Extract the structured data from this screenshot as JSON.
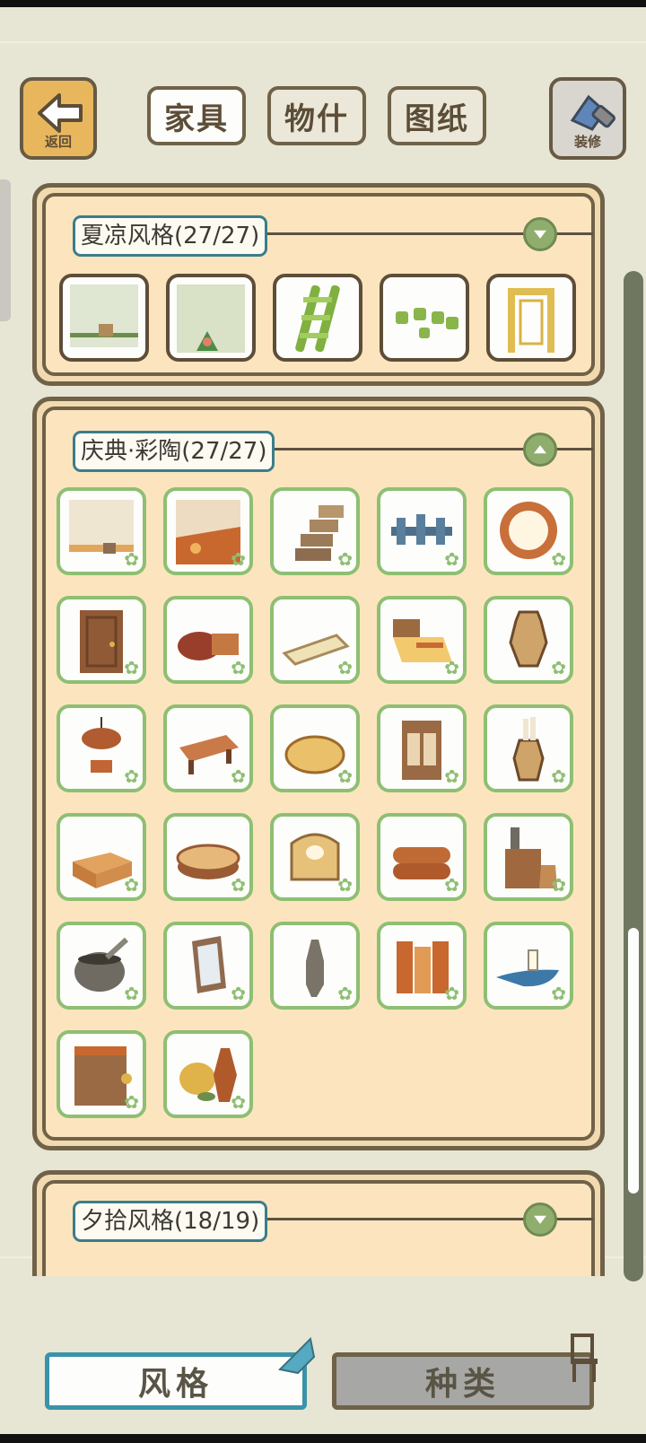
{
  "header": {
    "back_label": "返回",
    "decorate_label": "装修",
    "tabs": [
      {
        "label": "家具",
        "active": true
      },
      {
        "label": "物什",
        "active": false
      },
      {
        "label": "图纸",
        "active": false
      }
    ]
  },
  "sections": [
    {
      "title": "夏凉风格(27/27)",
      "state": "collapsed"
    },
    {
      "title": "庆典·彩陶(27/27)",
      "state": "expanded"
    },
    {
      "title": "夕拾风格(18/19)",
      "state": "collapsed"
    }
  ],
  "bottom": {
    "style_label": "风格",
    "kind_label": "种类"
  },
  "colors": {
    "background": "#e7e5d3",
    "panel": "#fce5be",
    "accent_teal": "#3a93a8",
    "item_green": "#8ebf73"
  }
}
